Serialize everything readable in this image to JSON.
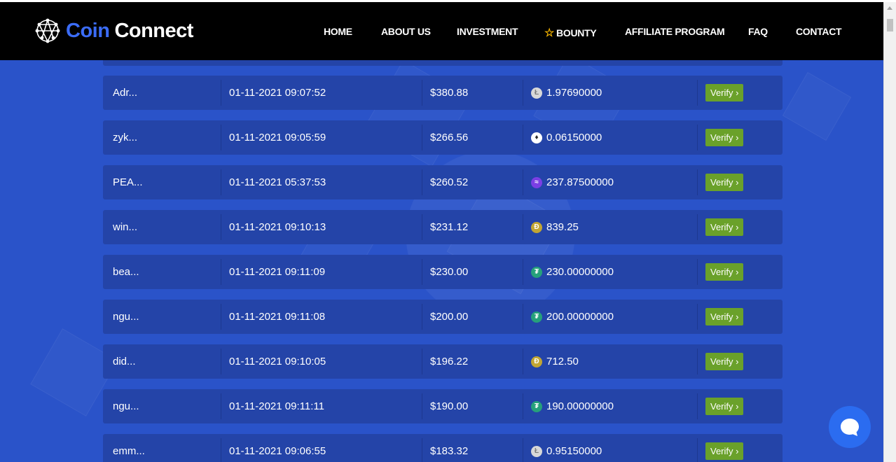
{
  "brand": {
    "name_part1": "Coin",
    "name_part2": "Connect"
  },
  "nav": {
    "home": "HOME",
    "about": "ABOUT US",
    "investment": "INVESTMENT",
    "bounty": "BOUNTY",
    "affiliate": "AFFILIATE PROGRAM",
    "faq": "FAQ",
    "contact": "CONTACT"
  },
  "transactions": [
    {
      "user": "Adr...",
      "date": "01-11-2021 09:07:52",
      "amount": "$380.88",
      "coin_icon": "litecoin-icon",
      "coin_glyph": "Ł",
      "coin_amount": "1.97690000",
      "verify": "Verify ›"
    },
    {
      "user": "zyk...",
      "date": "01-11-2021 09:05:59",
      "amount": "$266.56",
      "coin_icon": "ethereum-icon",
      "coin_glyph": "♦",
      "coin_amount": "0.06150000",
      "verify": "Verify ›"
    },
    {
      "user": "PEA...",
      "date": "01-11-2021 05:37:53",
      "amount": "$260.52",
      "coin_icon": "stellar-icon",
      "coin_glyph": "≈",
      "coin_amount": "237.87500000",
      "verify": "Verify ›"
    },
    {
      "user": "win...",
      "date": "01-11-2021 09:10:13",
      "amount": "$231.12",
      "coin_icon": "dogecoin-icon",
      "coin_glyph": "Ð",
      "coin_amount": "839.25",
      "verify": "Verify ›"
    },
    {
      "user": "bea...",
      "date": "01-11-2021 09:11:09",
      "amount": "$230.00",
      "coin_icon": "tether-icon",
      "coin_glyph": "₮",
      "coin_amount": "230.00000000",
      "verify": "Verify ›"
    },
    {
      "user": "ngu...",
      "date": "01-11-2021 09:11:08",
      "amount": "$200.00",
      "coin_icon": "tether-icon",
      "coin_glyph": "₮",
      "coin_amount": "200.00000000",
      "verify": "Verify ›"
    },
    {
      "user": "did...",
      "date": "01-11-2021 09:10:05",
      "amount": "$196.22",
      "coin_icon": "dogecoin-icon",
      "coin_glyph": "Ð",
      "coin_amount": "712.50",
      "verify": "Verify ›"
    },
    {
      "user": "ngu...",
      "date": "01-11-2021 09:11:11",
      "amount": "$190.00",
      "coin_icon": "tether-icon",
      "coin_glyph": "₮",
      "coin_amount": "190.00000000",
      "verify": "Verify ›"
    },
    {
      "user": "emm...",
      "date": "01-11-2021 09:06:55",
      "amount": "$183.32",
      "coin_icon": "litecoin-icon",
      "coin_glyph": "Ł",
      "coin_amount": "0.95150000",
      "verify": "Verify ›"
    }
  ],
  "colors": {
    "header": "#000000",
    "background": "#2a53c9",
    "row": "#2444a8",
    "verify": "#6aa12a",
    "brand_accent": "#3b6cf6",
    "chat": "#2b6cf0"
  }
}
